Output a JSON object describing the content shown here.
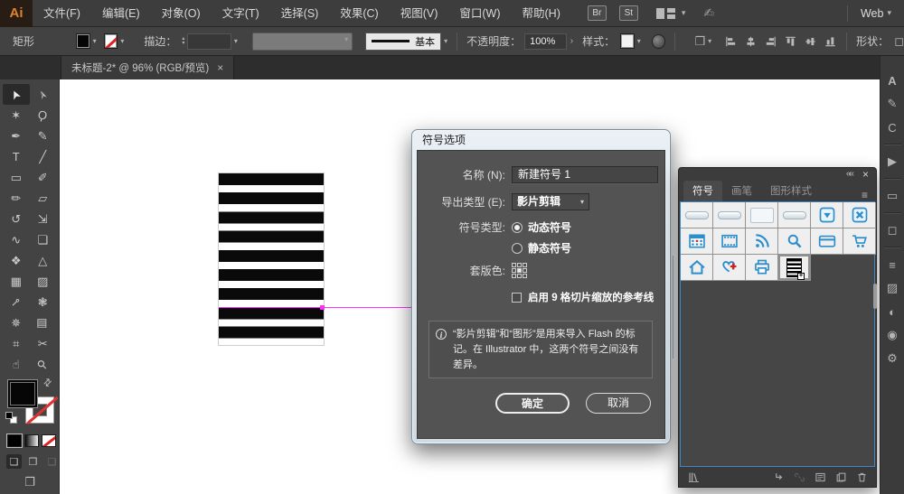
{
  "menubar": {
    "logo": "Ai",
    "items": [
      "文件(F)",
      "编辑(E)",
      "对象(O)",
      "文字(T)",
      "选择(S)",
      "效果(C)",
      "视图(V)",
      "窗口(W)",
      "帮助(H)"
    ],
    "badge_bridge": "Br",
    "badge_stock": "St",
    "workspace": "Web"
  },
  "controlbar": {
    "selection": "矩形",
    "stroke_label": "描边：",
    "brush": "基本",
    "opacity_label": "不透明度：",
    "opacity": "100%",
    "style_label": "样式：",
    "shape_label": "形状：",
    "align_icons": [
      "align-left",
      "align-center",
      "align-right",
      "align-top",
      "align-middle",
      "align-bottom"
    ]
  },
  "tabbar": {
    "title": "未标题-2* @ 96% (RGB/预览)",
    "close": "×"
  },
  "toolbar": {
    "tools": [
      "selection",
      "direct-selection",
      "magic-wand",
      "lasso",
      "pen",
      "curvature",
      "type",
      "line-segment",
      "rectangle",
      "paintbrush",
      "shaper",
      "eraser",
      "rotate",
      "scale",
      "width",
      "free-transform",
      "shape-builder",
      "perspective-grid",
      "mesh",
      "gradient",
      "eyedropper",
      "blend",
      "symbol-sprayer",
      "column-graph",
      "artboard",
      "slice",
      "hand",
      "zoom"
    ]
  },
  "dialog": {
    "title": "符号选项",
    "name_label": "名称 (N):",
    "name_value": "新建符号 1",
    "export_label": "导出类型 (E):",
    "export_value": "影片剪辑",
    "type_label": "符号类型:",
    "radio_dynamic": "动态符号",
    "radio_static": "静态符号",
    "registration_label": "套版色:",
    "checkbox_label": "启用 9 格切片缩放的参考线",
    "info_text": "“影片剪辑”和“图形”是用来导入 Flash 的标记。在 Illustrator 中，这两个符号之间没有差异。",
    "ok": "确定",
    "cancel": "取消"
  },
  "symbols_panel": {
    "tabs": [
      {
        "label": "符号",
        "active": true
      },
      {
        "label": "画笔",
        "active": false
      },
      {
        "label": "图形样式",
        "active": false
      }
    ],
    "symbols": [
      "bar-button-1",
      "bar-button-2",
      "panel-rect",
      "bar-button-3",
      "dropdown-button",
      "close-button",
      "calendar",
      "filmstrip",
      "rss",
      "search",
      "credit-card",
      "shopping-cart",
      "home",
      "first-aid-heart",
      "printer",
      "new-symbol-stripes"
    ],
    "selected_symbol": "new-symbol-stripes",
    "footer": [
      "library",
      "place-symbol",
      "break-link",
      "symbol-options",
      "new-symbol",
      "delete-symbol"
    ]
  },
  "dock": {
    "groups": [
      [
        "character-panel",
        "swatches",
        "color-guide"
      ],
      [
        "actions"
      ],
      [
        "artboard-panel"
      ],
      [
        "transform-panel"
      ],
      [
        "stroke-panel",
        "gradient-panel",
        "appearance-panel",
        "symbols-panel",
        "settings"
      ]
    ]
  },
  "colors": {
    "symbol_blue": "#2e8ecb",
    "magenta": "#ff2fff",
    "panel_border_blue": "#3f87c4",
    "badge_red": "#cc2222"
  }
}
